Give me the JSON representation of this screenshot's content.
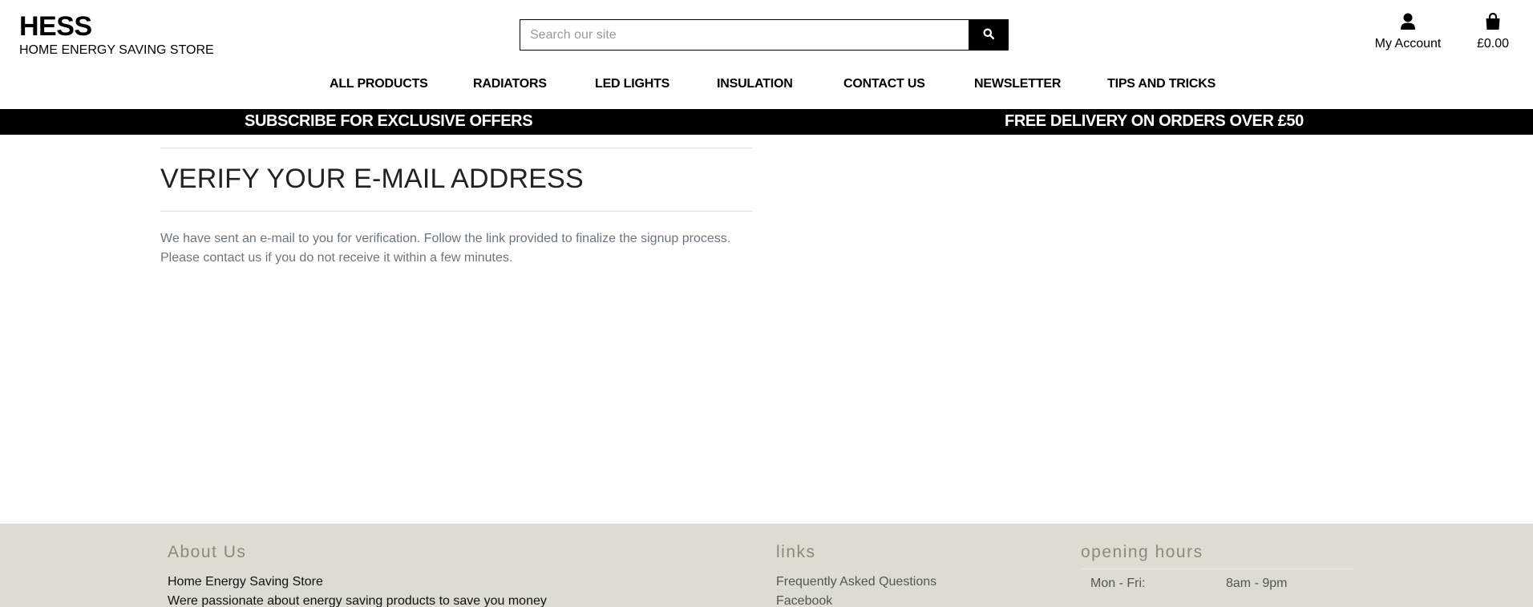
{
  "brand": {
    "title": "HESS",
    "subtitle": "HOME ENERGY SAVING STORE"
  },
  "search": {
    "placeholder": "Search our site",
    "value": "",
    "button_icon": "search-icon"
  },
  "account": {
    "label": "My Account",
    "icon": "user-icon"
  },
  "cart": {
    "total": "£0.00",
    "icon": "shopping-bag-icon"
  },
  "nav": {
    "items": [
      {
        "label": "ALL PRODUCTS"
      },
      {
        "label": "RADIATORS"
      },
      {
        "label": "LED LIGHTS"
      },
      {
        "label": "INSULATION"
      },
      {
        "label": "CONTACT US"
      },
      {
        "label": "NEWSLETTER"
      },
      {
        "label": "TIPS AND TRICKS"
      }
    ]
  },
  "promo": {
    "left": "SUBSCRIBE FOR EXCLUSIVE OFFERS",
    "right": "FREE DELIVERY ON ORDERS OVER £50"
  },
  "main": {
    "title": "VERIFY YOUR E-MAIL ADDRESS",
    "message_line1": "We have sent an e-mail to you for verification. Follow the link provided to finalize the signup process.",
    "message_line2": "Please contact us if you do not receive it within a few minutes."
  },
  "footer": {
    "about": {
      "heading": "About Us",
      "name": "Home Energy Saving Store",
      "tagline": "Were passionate about energy saving products to save you money"
    },
    "links": {
      "heading": "links",
      "items": [
        {
          "label": "Frequently Asked Questions"
        },
        {
          "label": "Facebook"
        }
      ]
    },
    "hours": {
      "heading": "opening hours",
      "rows": [
        {
          "day": "Mon - Fri:",
          "time": "8am - 9pm"
        }
      ]
    }
  },
  "colors": {
    "promo_bg": "#000000",
    "footer_bg": "#dcdcd2",
    "footer_heading": "#8a8a78",
    "message_text": "#6c757d"
  }
}
